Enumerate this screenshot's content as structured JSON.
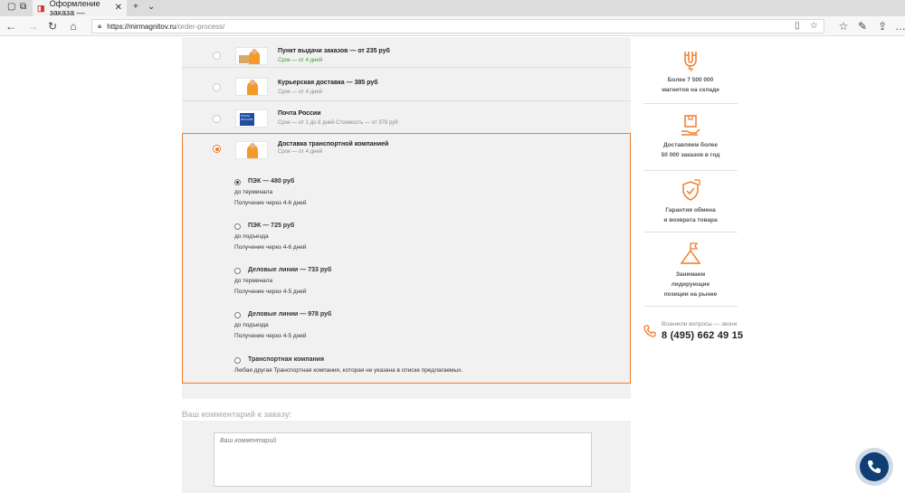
{
  "browser": {
    "tab_title": "Оформление заказа —",
    "url_host": "https://mirmagnitov.ru",
    "url_path": "/order-process/"
  },
  "shipping_options": [
    {
      "title": "Пункт выдачи заказов — от 235 руб",
      "sub": "Срок — от 4 дней"
    },
    {
      "title": "Курьерская доставка — 385 руб",
      "sub": "Срок — от 4 дней"
    },
    {
      "title": "Почта России",
      "sub": "Срок — от 1   до 8 дней   Стоимость — от 378 руб"
    },
    {
      "title": "Доставка транспортной компанией",
      "sub": "Срок — от 4 дней"
    }
  ],
  "post_logo_text": "ПОЧТА РОССИИ",
  "carriers": [
    {
      "title": "ПЭК — 480 руб",
      "line1": "до терминала",
      "line2": "Получение через 4-6 дней"
    },
    {
      "title": "ПЭК — 725 руб",
      "line1": "до подъезда",
      "line2": "Получение через 4-6 дней"
    },
    {
      "title": "Деловые линии — 733 руб",
      "line1": "до терминала",
      "line2": "Получение через 4-5 дней"
    },
    {
      "title": "Деловые линии — 978 руб",
      "line1": "до подъезда",
      "line2": "Получение через 4-5 дней"
    },
    {
      "title": "Транспортная компания",
      "line1": "Любая другая Транспортная компания, которая не указана в списке предлагаемых."
    }
  ],
  "comment": {
    "label": "Ваш комментарий к заказу:",
    "placeholder": "Ваш комментарий"
  },
  "sidebar": [
    {
      "icon": "magnet-icon",
      "line1": "Более 7 500 000",
      "line2": "магнитов на складе"
    },
    {
      "icon": "delivery-box-icon",
      "line1": "Доставляем более",
      "line2": "50 000 заказов в год"
    },
    {
      "icon": "shield-check-icon",
      "line1": "Гарантия обмена",
      "line2": "и возврата товара"
    },
    {
      "icon": "flag-mountain-icon",
      "line1": "Занимаем",
      "line2": "лидирующие",
      "line3": "позиции на рынке"
    }
  ],
  "contact": {
    "question": "Возникли вопросы — звони",
    "phone": "8 (495) 662 49 15"
  },
  "colors": {
    "accent": "#f07c2a",
    "call_button": "#0f3e74"
  }
}
